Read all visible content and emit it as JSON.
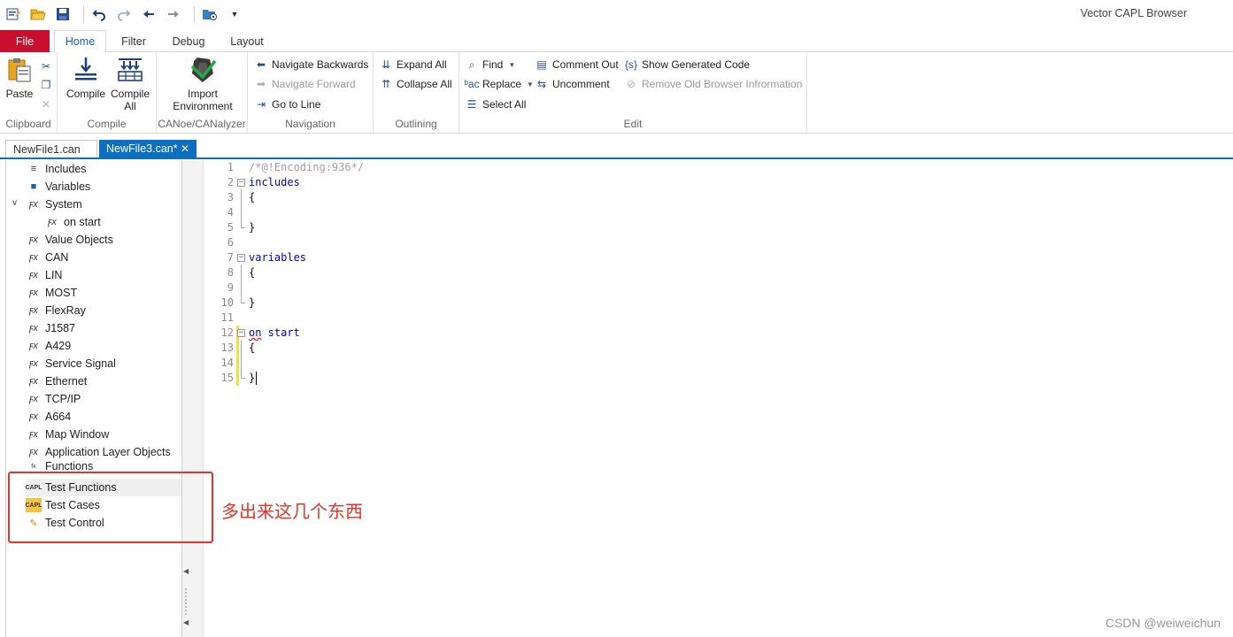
{
  "app": {
    "title": "Vector CAPL Browser"
  },
  "quick_access": {
    "icons": [
      "customize-icon",
      "open-folder-icon",
      "save-icon",
      "undo-icon",
      "redo-icon",
      "back-arrow-icon",
      "forward-arrow-icon",
      "folder-settings-icon",
      "dropdown-icon"
    ]
  },
  "ribbon_tabs": {
    "file": "File",
    "tabs": [
      "Home",
      "Filter",
      "Debug",
      "Layout"
    ],
    "active": "Home"
  },
  "ribbon": {
    "clipboard": {
      "label": "Clipboard",
      "paste": "Paste"
    },
    "compile": {
      "label": "Compile",
      "compile": "Compile",
      "compile_all_1": "Compile",
      "compile_all_2": "All"
    },
    "canoe": {
      "label": "CANoe/CANalyzer",
      "import_1": "Import",
      "import_2": "Environment"
    },
    "navigation": {
      "label": "Navigation",
      "back": "Navigate Backwards",
      "forward": "Navigate Forward",
      "goto": "Go to Line"
    },
    "outlining": {
      "label": "Outlining",
      "expand": "Expand All",
      "collapse": "Collapse All"
    },
    "edit": {
      "label": "Edit",
      "find": "Find",
      "replace": "Replace",
      "select_all": "Select All",
      "comment_out": "Comment Out",
      "uncomment": "Uncomment",
      "show_generated": "Show Generated Code",
      "remove_old": "Remove Old Browser Infrormation"
    }
  },
  "doc_tabs": [
    {
      "label": "NewFile1.can",
      "active": false
    },
    {
      "label": "NewFile3.can*",
      "active": true
    }
  ],
  "tree": {
    "items": [
      {
        "label": "Includes",
        "icon": "includes-icon"
      },
      {
        "label": "Variables",
        "icon": "variables-icon"
      },
      {
        "label": "System",
        "icon": "function-icon",
        "expanded": true
      },
      {
        "label": "on start",
        "icon": "function-icon"
      },
      {
        "label": "Value Objects",
        "icon": "function-icon"
      },
      {
        "label": "CAN",
        "icon": "function-icon"
      },
      {
        "label": "LIN",
        "icon": "function-icon"
      },
      {
        "label": "MOST",
        "icon": "function-icon"
      },
      {
        "label": "FlexRay",
        "icon": "function-icon"
      },
      {
        "label": "J1587",
        "icon": "function-icon"
      },
      {
        "label": "A429",
        "icon": "function-icon"
      },
      {
        "label": "Service Signal",
        "icon": "function-icon"
      },
      {
        "label": "Ethernet",
        "icon": "function-icon"
      },
      {
        "label": "TCP/IP",
        "icon": "function-icon"
      },
      {
        "label": "A664",
        "icon": "function-icon"
      },
      {
        "label": "Map Window",
        "icon": "function-icon"
      },
      {
        "label": "Application Layer Objects",
        "icon": "function-icon"
      },
      {
        "label": "Functions",
        "icon": "capl-function-icon"
      },
      {
        "label": "Test Functions",
        "icon": "capl-test-function-icon"
      },
      {
        "label": "Test Cases",
        "icon": "capl-test-case-icon"
      },
      {
        "label": "Test Control",
        "icon": "test-control-icon"
      }
    ]
  },
  "editor": {
    "lines": [
      {
        "n": "1",
        "text": "/*@!Encoding:936*/"
      },
      {
        "n": "2",
        "text": "includes"
      },
      {
        "n": "3",
        "text": "{"
      },
      {
        "n": "4",
        "text": ""
      },
      {
        "n": "5",
        "text": "}"
      },
      {
        "n": "6",
        "text": ""
      },
      {
        "n": "7",
        "text": "variables"
      },
      {
        "n": "8",
        "text": "{"
      },
      {
        "n": "9",
        "text": ""
      },
      {
        "n": "10",
        "text": "}"
      },
      {
        "n": "11",
        "text": ""
      },
      {
        "n": "12",
        "text_kw": "on",
        "text_rest": " start"
      },
      {
        "n": "13",
        "text": "{"
      },
      {
        "n": "14",
        "text": ""
      },
      {
        "n": "15",
        "text": "}"
      }
    ]
  },
  "annotation": {
    "text": "多出来这几个东西"
  },
  "watermark": "CSDN @weiweichun",
  "colors": {
    "file_tab": "#c8102e",
    "accent": "#0e6fc1",
    "annotation": "#e8322a"
  }
}
